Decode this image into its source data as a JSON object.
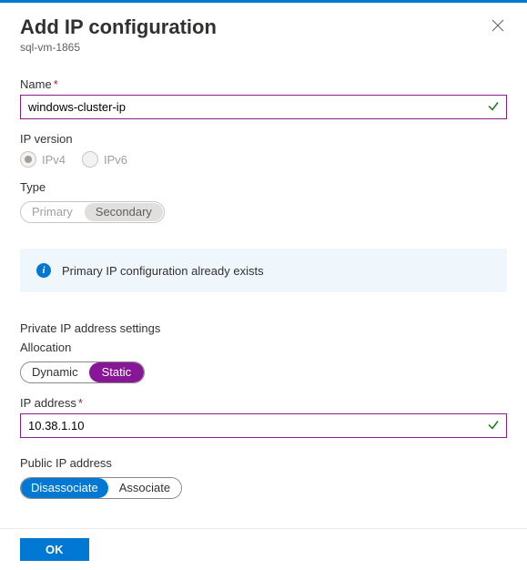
{
  "header": {
    "title": "Add IP configuration",
    "subtitle": "sql-vm-1865"
  },
  "name": {
    "label": "Name",
    "value": "windows-cluster-ip"
  },
  "ip_version": {
    "label": "IP version",
    "options": {
      "ipv4": "IPv4",
      "ipv6": "IPv6"
    },
    "selected": "ipv4"
  },
  "type": {
    "label": "Type",
    "options": {
      "primary": "Primary",
      "secondary": "Secondary"
    },
    "selected": "secondary"
  },
  "info": {
    "text": "Primary IP configuration already exists"
  },
  "private_ip": {
    "heading": "Private IP address settings",
    "allocation": {
      "label": "Allocation",
      "options": {
        "dynamic": "Dynamic",
        "static": "Static"
      },
      "selected": "static"
    },
    "address": {
      "label": "IP address",
      "value": "10.38.1.10"
    }
  },
  "public_ip": {
    "label": "Public IP address",
    "options": {
      "disassociate": "Disassociate",
      "associate": "Associate"
    },
    "selected": "disassociate"
  },
  "footer": {
    "ok": "OK"
  }
}
